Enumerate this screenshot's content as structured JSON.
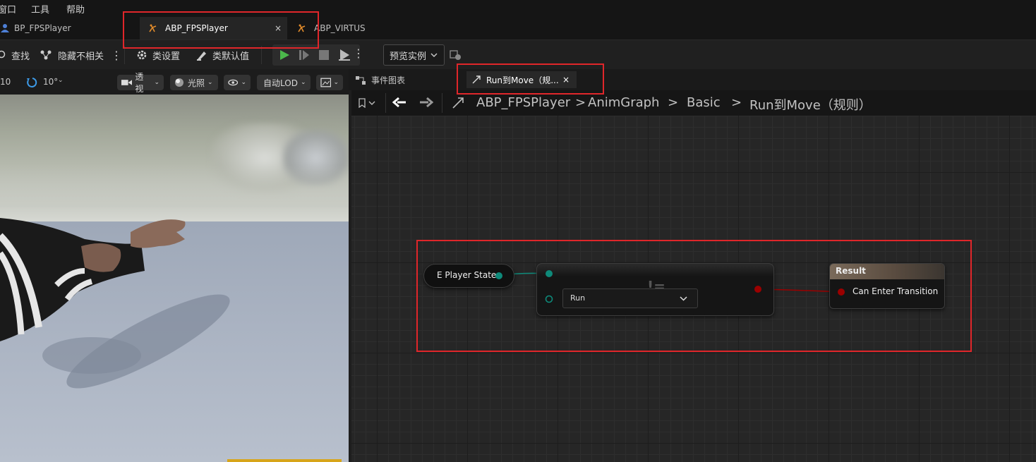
{
  "menu": {
    "window": "窗口",
    "tools": "工具",
    "help": "帮助"
  },
  "tabs": {
    "bp": "BP_FPSPlayer",
    "abp": "ABP_FPSPlayer",
    "virtus": "ABP_VIRTUS",
    "close": "×"
  },
  "toolbar": {
    "find": "查找",
    "hide_unrelated": "隐藏不相关",
    "class_settings": "类设置",
    "class_defaults": "类默认值",
    "preview_instance": "预览实例"
  },
  "viewport_toolbar": {
    "grid_snap": "10",
    "rot_snap": "10°",
    "perspective": "透视",
    "lit": "光照",
    "lod": "自动LOD"
  },
  "graph": {
    "event_graph_tab": "事件图表",
    "rule_tab": "Run到Move（规...",
    "rule_tab_close": "×",
    "breadcrumb": [
      "ABP_FPSPlayer",
      "AnimGraph",
      "Basic",
      "Run到Move（规则）"
    ]
  },
  "nodes": {
    "var_label": "E Player State",
    "enum_value": "Run",
    "op_symbol": "!=",
    "result_title": "Result",
    "result_pin": "Can Enter Transition"
  },
  "colors": {
    "accent_highlight": "#e0262a",
    "enum_pin": "#0e8a7a",
    "bool_pin": "#9b0000"
  }
}
